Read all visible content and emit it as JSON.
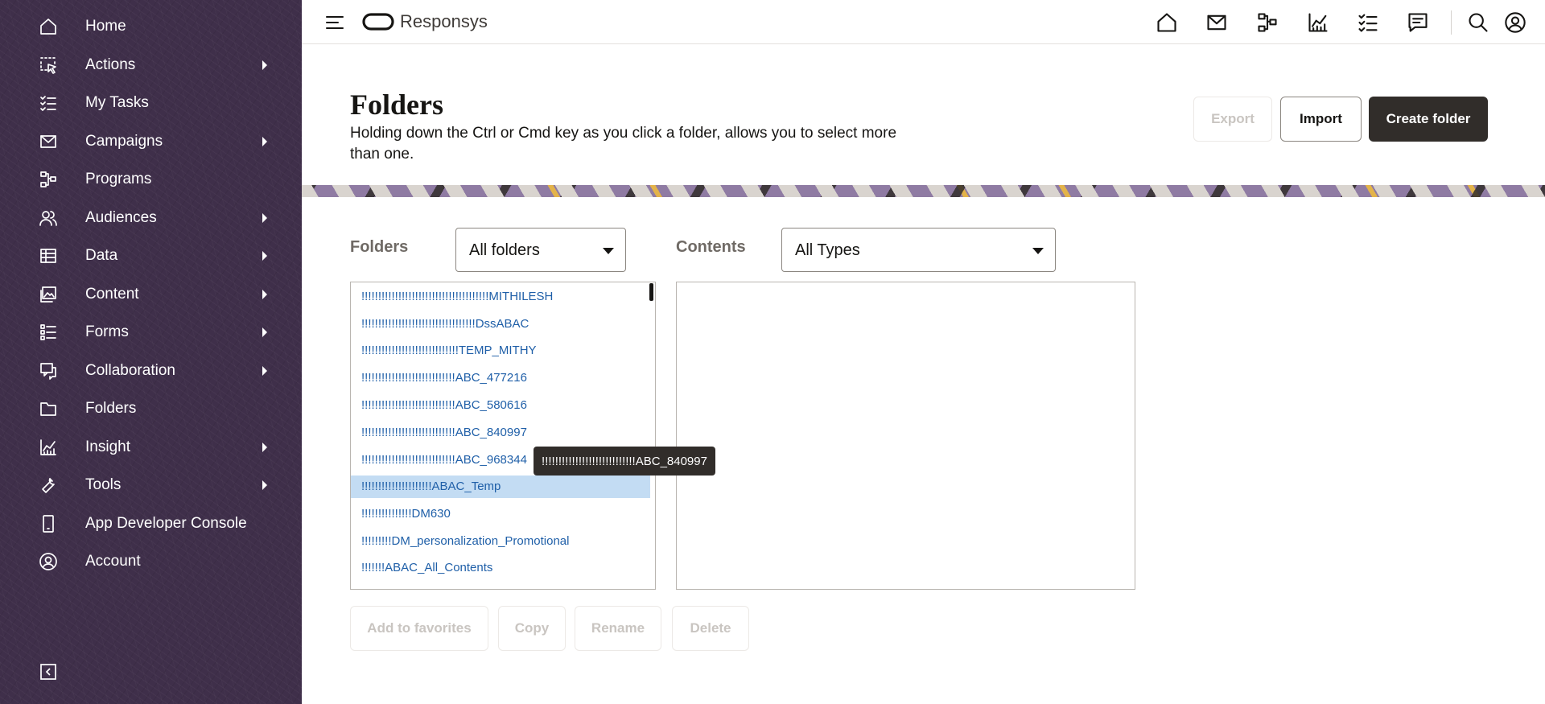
{
  "app": {
    "brand": "Responsys"
  },
  "sidebar": {
    "items": [
      {
        "label": "Home",
        "icon": "home-icon",
        "has_submenu": false
      },
      {
        "label": "Actions",
        "icon": "actions-icon",
        "has_submenu": true
      },
      {
        "label": "My Tasks",
        "icon": "tasks-icon",
        "has_submenu": false
      },
      {
        "label": "Campaigns",
        "icon": "mail-icon",
        "has_submenu": true
      },
      {
        "label": "Programs",
        "icon": "programs-icon",
        "has_submenu": false
      },
      {
        "label": "Audiences",
        "icon": "audiences-icon",
        "has_submenu": true
      },
      {
        "label": "Data",
        "icon": "data-table-icon",
        "has_submenu": true
      },
      {
        "label": "Content",
        "icon": "content-image-icon",
        "has_submenu": true
      },
      {
        "label": "Forms",
        "icon": "forms-icon",
        "has_submenu": true
      },
      {
        "label": "Collaboration",
        "icon": "collaboration-icon",
        "has_submenu": true
      },
      {
        "label": "Folders",
        "icon": "folder-icon",
        "has_submenu": false
      },
      {
        "label": "Insight",
        "icon": "insight-chart-icon",
        "has_submenu": true
      },
      {
        "label": "Tools",
        "icon": "wrench-icon",
        "has_submenu": true
      },
      {
        "label": "App Developer Console",
        "icon": "mobile-device-icon",
        "has_submenu": false
      },
      {
        "label": "Account",
        "icon": "account-icon",
        "has_submenu": false
      }
    ],
    "collapse_icon": "collapse-sidebar-icon"
  },
  "topbar": {
    "icons": [
      "home-icon",
      "mail-icon",
      "programs-icon",
      "insight-chart-icon",
      "tasks-icon",
      "chat-icon",
      "search-icon",
      "user-profile-icon"
    ]
  },
  "page": {
    "title": "Folders",
    "description": "Holding down the Ctrl or Cmd key as you click a folder, allows you to select more than one."
  },
  "header_buttons": {
    "export": "Export",
    "import": "Import",
    "create_folder": "Create folder"
  },
  "filters": {
    "folders_label": "Folders",
    "folders_value": "All folders",
    "contents_label": "Contents",
    "contents_value": "All Types"
  },
  "folders_list": {
    "items": [
      "!!!!!!!!!!!!!!!!!!!!!!!!!!!!!!!!!!!!!!MITHILESH",
      "!!!!!!!!!!!!!!!!!!!!!!!!!!!!!!!!!!DssABAC",
      "!!!!!!!!!!!!!!!!!!!!!!!!!!!!!TEMP_MITHY",
      "!!!!!!!!!!!!!!!!!!!!!!!!!!!!ABC_477216",
      "!!!!!!!!!!!!!!!!!!!!!!!!!!!!ABC_580616",
      "!!!!!!!!!!!!!!!!!!!!!!!!!!!!ABC_840997",
      "!!!!!!!!!!!!!!!!!!!!!!!!!!!!ABC_968344",
      "!!!!!!!!!!!!!!!!!!!!!ABAC_Temp",
      "!!!!!!!!!!!!!!!DM630",
      "!!!!!!!!!DM_personalization_Promotional",
      "!!!!!!!ABAC_All_Contents"
    ],
    "selected_index": 7
  },
  "tooltip": {
    "text": "!!!!!!!!!!!!!!!!!!!!!!!!!!!!ABC_840997"
  },
  "actions": {
    "add_to_favorites": "Add to favorites",
    "copy": "Copy",
    "rename": "Rename",
    "delete": "Delete"
  },
  "colors": {
    "sidebar_bg": "#3f2f4a",
    "link": "#1f5fa8",
    "selected_row": "#c3dcf3",
    "primary_button": "#312d2a"
  }
}
